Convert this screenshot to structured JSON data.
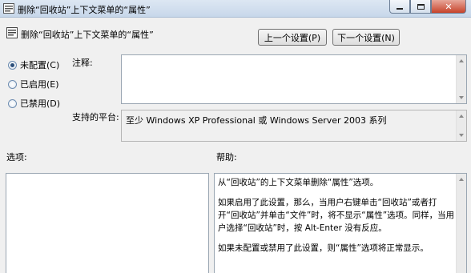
{
  "window": {
    "title": "删除“回收站”上下文菜单的“属性”"
  },
  "header": {
    "setting_title": "删除“回收站”上下文菜单的“属性”",
    "prev_button": "上一个设置(P)",
    "next_button": "下一个设置(N)"
  },
  "state": {
    "options": [
      {
        "label": "未配置(C)",
        "checked": true
      },
      {
        "label": "已启用(E)",
        "checked": false
      },
      {
        "label": "已禁用(D)",
        "checked": false
      }
    ]
  },
  "fields": {
    "comment_label": "注释:",
    "comment_value": "",
    "platform_label": "支持的平台:",
    "platform_value": "至少 Windows XP Professional 或 Windows Server 2003 系列"
  },
  "panels": {
    "options_label": "选项:",
    "help_label": "帮助:",
    "help_paragraphs": [
      "从“回收站”的上下文菜单删除“属性”选项。",
      "如果启用了此设置，那么，当用户右键单击“回收站”或者打开“回收站”并单击“文件”时，将不显示“属性”选项。同样，当用户选择“回收站”时，按 Alt-Enter 没有反应。",
      "如果未配置或禁用了此设置，则“属性”选项将正常显示。"
    ]
  },
  "icons": {
    "app": "policy-setting-icon",
    "header": "policy-setting-icon",
    "minimize": "minimize-icon",
    "maximize": "maximize-icon",
    "close": "close-icon"
  }
}
